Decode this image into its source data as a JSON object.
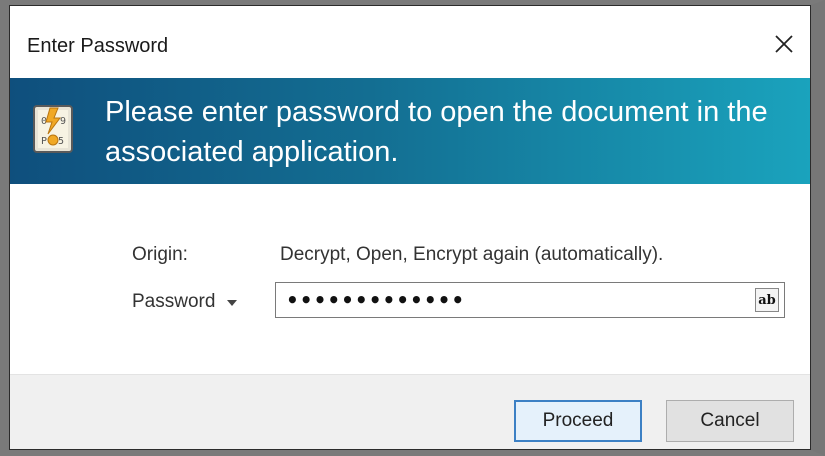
{
  "window": {
    "title": "Enter Password",
    "close_icon": "close-icon"
  },
  "banner": {
    "icon": "password-document-icon",
    "message": "Please enter password to open the document in the associated application."
  },
  "form": {
    "origin_label": "Origin:",
    "origin_value": "Decrypt, Open, Encrypt again (automatically).",
    "password_label": "Password",
    "password_masked": "•••••••••••••",
    "show_text_toggle": "ab"
  },
  "buttons": {
    "proceed": "Proceed",
    "cancel": "Cancel"
  },
  "colors": {
    "banner_start": "#0f4f7d",
    "banner_end": "#1aa3bd",
    "default_button_border": "#3c80c4"
  }
}
